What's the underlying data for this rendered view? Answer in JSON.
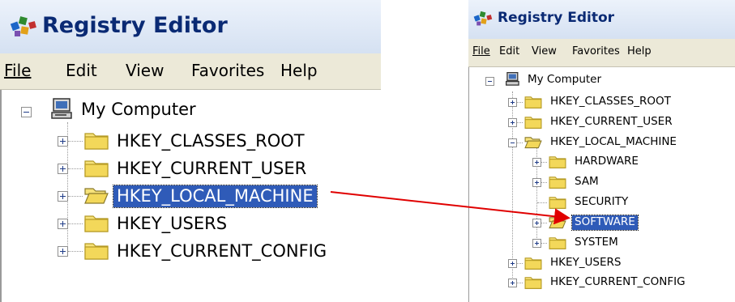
{
  "colors": {
    "selection": "#2f5bb8",
    "arrow": "#e00000",
    "title_text": "#0a2a74",
    "menubar": "#ece9d8"
  },
  "left": {
    "title": "Registry Editor",
    "menu": [
      "File",
      "Edit",
      "View",
      "Favorites",
      "Help"
    ],
    "tree": {
      "root": "My Computer",
      "keys": [
        "HKEY_CLASSES_ROOT",
        "HKEY_CURRENT_USER",
        "HKEY_LOCAL_MACHINE",
        "HKEY_USERS",
        "HKEY_CURRENT_CONFIG"
      ],
      "selected": "HKEY_LOCAL_MACHINE"
    }
  },
  "right": {
    "title": "Registry Editor",
    "menu": [
      "File",
      "Edit",
      "View",
      "Favorites",
      "Help"
    ],
    "tree": {
      "root": "My Computer",
      "keys": [
        "HKEY_CLASSES_ROOT",
        "HKEY_CURRENT_USER",
        "HKEY_LOCAL_MACHINE",
        "HKEY_USERS",
        "HKEY_CURRENT_CONFIG"
      ],
      "hklm_children": [
        "HARDWARE",
        "SAM",
        "SECURITY",
        "SOFTWARE",
        "SYSTEM"
      ],
      "selected": "SOFTWARE"
    }
  },
  "icons": {
    "app": "registry-editor-icon",
    "computer": "computer-icon",
    "folder": "folder-icon",
    "open_folder": "open-folder-icon",
    "expand": "plus-box-icon",
    "collapse": "minus-box-icon"
  }
}
